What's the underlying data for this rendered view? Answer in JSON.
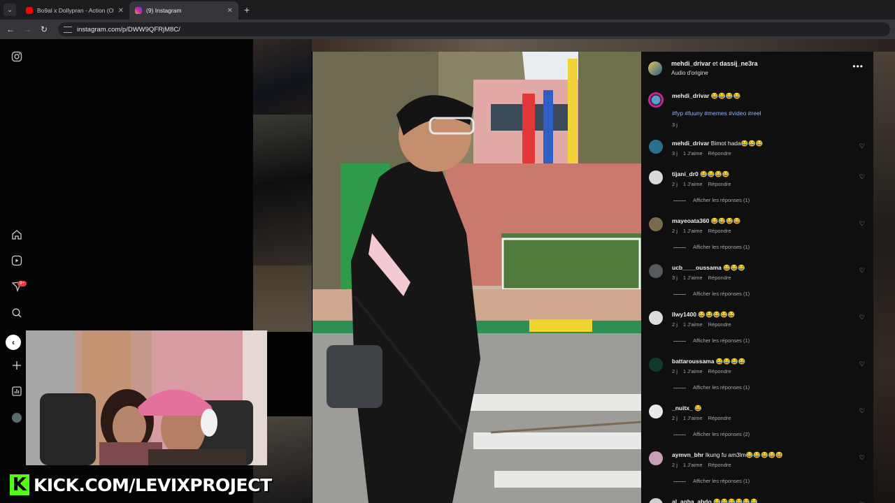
{
  "browser": {
    "tabs": [
      {
        "title": "Bo9al x Dollypran - Action (Offi",
        "favicon_color": "#ff0000",
        "active": false
      },
      {
        "title": "(9) Instagram",
        "favicon_color": "#d6249f",
        "active": true
      }
    ],
    "url": "instagram.com/p/DWW9QFRjM8C/"
  },
  "sidebar": {
    "icons": [
      "instagram-icon",
      "home-icon",
      "reels-icon",
      "messages-icon",
      "search-icon",
      "create-icon",
      "dashboard-icon",
      "profile-icon"
    ],
    "notification_badge": "9+"
  },
  "post": {
    "author_line_user1": "mehdi_drivar",
    "author_line_connector": "et",
    "author_line_user2": "dassij_ne3ra",
    "audio": "Audio d'origine",
    "caption_user": "mehdi_drivar",
    "caption_text": "😂😂😂😂",
    "hashtags": "#fyp #fuuny #memes #video #reel",
    "caption_age": "3 j"
  },
  "comments": [
    {
      "user": "mehdi_drivar",
      "text": "Bimot hada😂😂😂",
      "age": "3 j",
      "likes": "1 J'aime",
      "reply": "Répondre",
      "replies": ""
    },
    {
      "user": "tijani_dr0",
      "text": "😂😂😂😂",
      "age": "2 j",
      "likes": "1 J'aime",
      "reply": "Répondre",
      "replies": "Afficher les réponses (1)"
    },
    {
      "user": "mayeoata360",
      "text": "😂😂😂😂",
      "age": "2 j",
      "likes": "1 J'aime",
      "reply": "Répondre",
      "replies": "Afficher les réponses (1)"
    },
    {
      "user": "ucb____oussama",
      "text": "😂😂😂",
      "age": "3 j",
      "likes": "1 J'aime",
      "reply": "Répondre",
      "replies": "Afficher les réponses (1)"
    },
    {
      "user": "llwy1400",
      "text": "😂😂😂😂😂",
      "age": "2 j",
      "likes": "1 J'aime",
      "reply": "Répondre",
      "replies": "Afficher les réponses (1)"
    },
    {
      "user": "battaroussama",
      "text": "😂😂😂😂",
      "age": "2 j",
      "likes": "1 J'aime",
      "reply": "Répondre",
      "replies": "Afficher les réponses (1)"
    },
    {
      "user": "_nuitx_",
      "text": "😂",
      "age": "2 j",
      "likes": "1 J'aime",
      "reply": "Répondre",
      "replies": "Afficher les réponses (2)"
    },
    {
      "user": "aymvn_bhr",
      "text": "Ikung fu am3lm😂😂😂😂😆",
      "age": "2 j",
      "likes": "1 J'aime",
      "reply": "Répondre",
      "replies": "Afficher les réponses (1)"
    },
    {
      "user": "al_agha_abdo",
      "text": "😂😂😂😂😂😂",
      "age": "",
      "likes": "",
      "reply": "",
      "replies": ""
    }
  ],
  "overlay": {
    "kick_letter": "K",
    "kick_text": "KICK.COM/LEVIXPROJECT"
  }
}
